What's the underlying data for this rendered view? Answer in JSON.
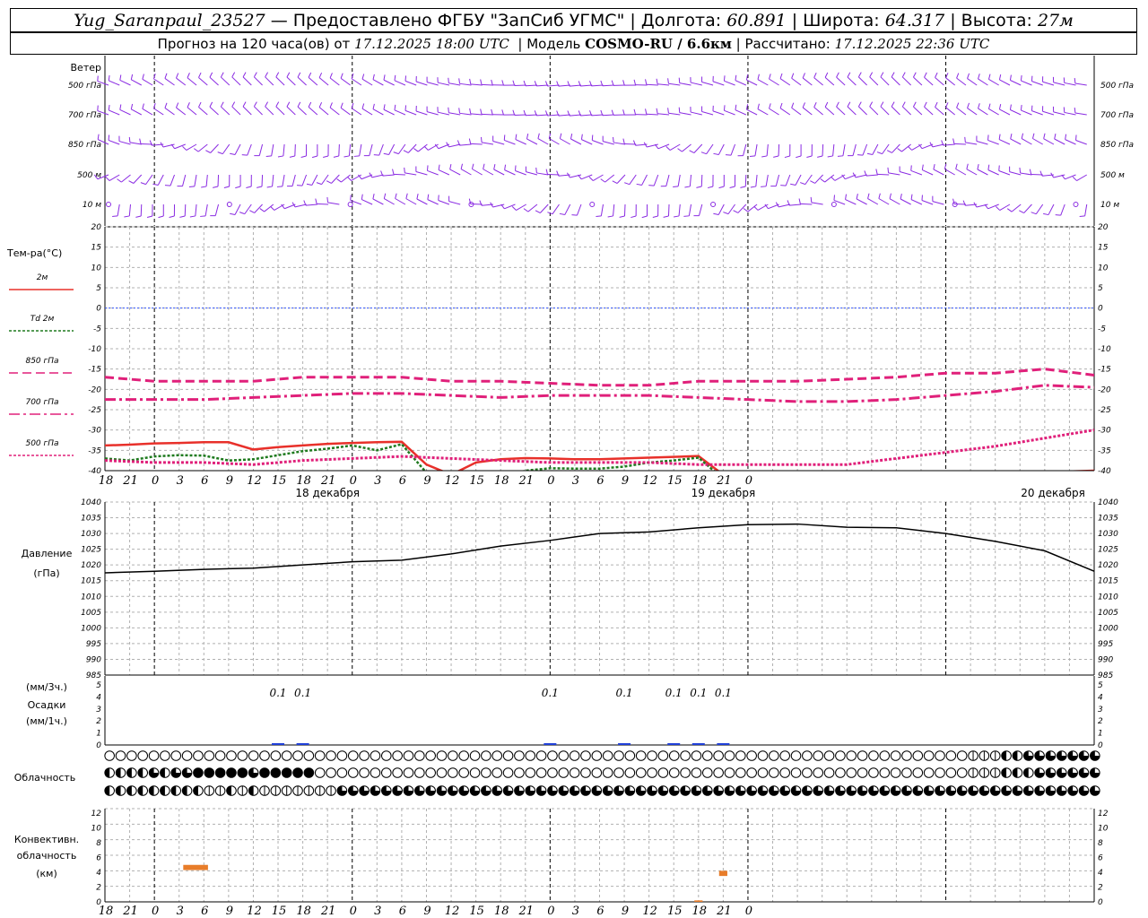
{
  "header": {
    "station": "Yug_Saranpaul_23527",
    "provider": "— Предоставлено ФГБУ \"ЗапСиб УГМС\"",
    "lon_label": "Долгота:",
    "lon": "60.891",
    "lat_label": "Широта:",
    "lat": "64.317",
    "alt_label": "Высота:",
    "alt": "27м",
    "fc_label": "Прогноз на 120 часа(ов) от",
    "fc_time": "17.12.2025 18:00 UTC",
    "model_label": "Модель",
    "model": "COSMO-RU / 6.6км",
    "calc_label": "Рассчитано:",
    "calc_time": "17.12.2025 22:36 UTC"
  },
  "wind_panel": {
    "title": "Ветер",
    "levels": [
      "500 гПа",
      "700 гПа",
      "850 гПа",
      "500 м",
      "10 м"
    ],
    "barb_color": "#8a2be2"
  },
  "temp_panel": {
    "title": "Тем-ра(°С)",
    "legend": [
      {
        "name": "2м",
        "color": "#e8302a",
        "style": "solid"
      },
      {
        "name": "Td 2м",
        "color": "#1e7a1e",
        "style": "dotted"
      },
      {
        "name": "850 гПа",
        "color": "#e0207a",
        "style": "dashed"
      },
      {
        "name": "700 гПа",
        "color": "#e0207a",
        "style": "dashdot"
      },
      {
        "name": "500 гПа",
        "color": "#e0207a",
        "style": "dotted"
      }
    ],
    "ticks": [
      "20",
      "15",
      "10",
      "5",
      "0",
      "-5",
      "-10",
      "-15",
      "-20",
      "-25",
      "-30",
      "-35",
      "-40"
    ]
  },
  "time_axis": {
    "hours": [
      "18",
      "21",
      "0",
      "3",
      "6",
      "9",
      "12",
      "15",
      "18",
      "21",
      "0",
      "3",
      "6",
      "9",
      "12",
      "15",
      "18",
      "21",
      "0",
      "3",
      "6",
      "9",
      "12",
      "15",
      "18",
      "21",
      "0"
    ],
    "days": [
      "18 декабря",
      "19 декабря",
      "20 декабря"
    ]
  },
  "pressure_panel": {
    "title": "Давление",
    "unit": "(гПа)",
    "ticks": [
      "1040",
      "1035",
      "1030",
      "1025",
      "1020",
      "1015",
      "1010",
      "1005",
      "1000",
      "995",
      "990",
      "985"
    ]
  },
  "precip_panel": {
    "unit3": "(мм/3ч.)",
    "title": "Осадки",
    "unit1": "(мм/1ч.)",
    "ticks": [
      "5",
      "4",
      "3",
      "2",
      "1",
      "0"
    ],
    "labels": [
      {
        "hour": 21,
        "text": "0.1"
      },
      {
        "hour": 24,
        "text": "0.1"
      },
      {
        "hour": 54,
        "text": "0.1"
      },
      {
        "hour": 63,
        "text": "0.1"
      },
      {
        "hour": 69,
        "text": "0.1"
      },
      {
        "hour": 72,
        "text": "0.1"
      },
      {
        "hour": 75,
        "text": "0.1"
      }
    ]
  },
  "cloud_panel": {
    "title": "Облачность"
  },
  "conv_panel": {
    "title1": "Конвективн.",
    "title2": "облачность",
    "unit": "(км)",
    "ticks": [
      "12",
      "10",
      "8",
      "6",
      "4",
      "2",
      "0"
    ],
    "bar_color": "#e87d2a"
  },
  "chart_data": [
    {
      "type": "line",
      "title": "Тем-ра(°С)",
      "x_unit": "hours from 17.12.2025 18:00 UTC",
      "ylim": [
        -40,
        20
      ],
      "grid": true,
      "series": [
        {
          "name": "2м",
          "x": [
            0,
            3,
            6,
            9,
            12,
            15,
            18,
            21,
            24,
            27,
            30,
            33,
            36,
            39,
            42,
            45,
            48,
            51,
            54,
            57,
            60,
            63,
            66,
            69,
            72,
            75,
            78,
            81,
            84,
            87,
            90,
            93,
            96,
            99,
            102,
            105,
            108,
            111,
            114,
            117,
            120
          ],
          "values": [
            -33.8,
            -33.6,
            -33.3,
            -33.2,
            -33.0,
            -33.0,
            -34.8,
            -34.2,
            -33.8,
            -33.4,
            -33.2,
            -33.0,
            -32.9,
            -38.5,
            -41.0,
            -38.0,
            -37.2,
            -36.9,
            -37.0,
            -37.2,
            -37.2,
            -37.0,
            -36.8,
            -36.6,
            -36.4,
            -41,
            -42,
            -42,
            -42,
            -42,
            -42,
            -42,
            -42,
            -42,
            -42,
            -42,
            -42,
            -42,
            -42,
            -40.2,
            -40.0
          ]
        },
        {
          "name": "Td 2м",
          "x": [
            0,
            3,
            6,
            9,
            12,
            15,
            18,
            21,
            24,
            27,
            30,
            33,
            36,
            39,
            42,
            45,
            48,
            51,
            54,
            57,
            60,
            63,
            66,
            69,
            72,
            75,
            78,
            81,
            84,
            87,
            90,
            93,
            96,
            99,
            102,
            105,
            108,
            111,
            114,
            117,
            120
          ],
          "values": [
            -37.0,
            -37.5,
            -36.5,
            -36.2,
            -36.3,
            -37.5,
            -37.2,
            -36.2,
            -35.2,
            -34.6,
            -33.8,
            -35.0,
            -33.5,
            -40.5,
            -42,
            -42,
            -42,
            -40.0,
            -39.4,
            -39.5,
            -39.5,
            -39.0,
            -38.0,
            -37.5,
            -36.8,
            -42,
            -42,
            -42,
            -42,
            -42,
            -42,
            -42,
            -42,
            -42,
            -42,
            -42,
            -42,
            -42,
            -42,
            -42,
            -42
          ]
        },
        {
          "name": "850 гПа",
          "x": [
            0,
            6,
            12,
            18,
            24,
            30,
            36,
            42,
            48,
            54,
            60,
            66,
            72,
            78,
            84,
            90,
            96,
            102,
            108,
            114,
            120
          ],
          "values": [
            -17,
            -18,
            -18,
            -18,
            -17,
            -17,
            -17,
            -18,
            -18,
            -18.5,
            -19,
            -19,
            -18,
            -18,
            -18,
            -17.5,
            -17,
            -16,
            -16,
            -15,
            -16.5
          ]
        },
        {
          "name": "700 гПа",
          "x": [
            0,
            6,
            12,
            18,
            24,
            30,
            36,
            42,
            48,
            54,
            60,
            66,
            72,
            78,
            84,
            90,
            96,
            102,
            108,
            114,
            120
          ],
          "values": [
            -22.5,
            -22.5,
            -22.5,
            -22,
            -21.5,
            -21,
            -21,
            -21.5,
            -22,
            -21.5,
            -21.5,
            -21.5,
            -22,
            -22.5,
            -23,
            -23,
            -22.5,
            -21.5,
            -20.5,
            -19,
            -19.5
          ]
        },
        {
          "name": "500 гПа",
          "x": [
            0,
            6,
            12,
            18,
            24,
            30,
            36,
            42,
            48,
            54,
            60,
            66,
            72,
            78,
            84,
            90,
            96,
            102,
            108,
            114,
            120
          ],
          "values": [
            -37.5,
            -38,
            -38,
            -38.5,
            -37.5,
            -37,
            -36.5,
            -37,
            -37.5,
            -38,
            -38,
            -38,
            -38.5,
            -38.5,
            -38.5,
            -38.5,
            -37,
            -35.5,
            -34,
            -32,
            -30
          ]
        }
      ]
    },
    {
      "type": "line",
      "title": "Давление",
      "ylabel": "(гПа)",
      "x_unit": "hours from 17.12.2025 18:00 UTC",
      "ylim": [
        985,
        1040
      ],
      "grid": true,
      "series": [
        {
          "x": [
            0,
            6,
            12,
            18,
            24,
            30,
            36,
            42,
            48,
            54,
            60,
            66,
            72,
            78,
            84,
            90,
            96,
            102,
            108,
            114,
            120
          ],
          "values": [
            1017.5,
            1018,
            1018.6,
            1019,
            1020,
            1021,
            1021.5,
            1023.5,
            1026,
            1027.8,
            1030,
            1030.5,
            1031.8,
            1032.8,
            1033,
            1032,
            1031.8,
            1030,
            1027.5,
            1024.5,
            1018
          ]
        }
      ]
    },
    {
      "type": "bar",
      "title": "Осадки",
      "ylim": [
        0,
        5
      ],
      "x_unit": "hours from 17.12.2025 18:00 UTC",
      "x": [
        21,
        24,
        54,
        63,
        69,
        72,
        75
      ],
      "values": [
        0.1,
        0.1,
        0.1,
        0.1,
        0.1,
        0.1,
        0.1
      ]
    },
    {
      "type": "bar",
      "title": "Конвективн. облачность",
      "ylabel": "(км)",
      "ylim": [
        0,
        13
      ],
      "x_unit": "hours from 17.12.2025 18:00 UTC",
      "bars": [
        {
          "x_start": 9.5,
          "x_end": 12.5,
          "bottom": 4.3,
          "top": 5.0
        },
        {
          "x_start": 74.5,
          "x_end": 75.5,
          "bottom": 3.5,
          "top": 4.2
        },
        {
          "x_start": 71.5,
          "x_end": 72.5,
          "bottom": 0.0,
          "top": 0.2
        }
      ]
    }
  ],
  "clouds": {
    "rows": [
      "high",
      "mid",
      "low"
    ],
    "high": "000000000000000000000000000000000000000000000000000000000000000000000000000000111223333333",
    "mid": "222232334444434444400000000000000000000000000000000000000000000000000000000000111222333333",
    "low": "222222222112121111111333333333333333333333333333333333333333333333333333333333333333333333"
  }
}
